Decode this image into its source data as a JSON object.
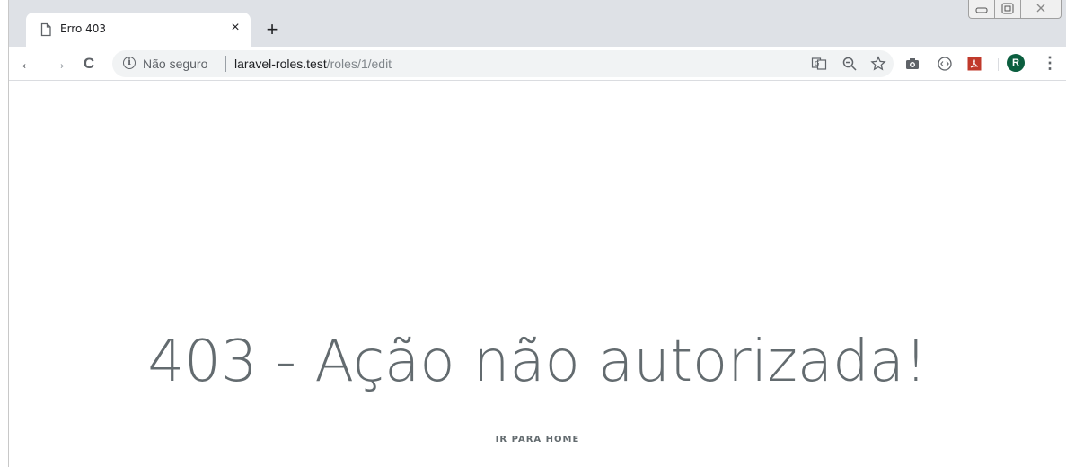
{
  "browser": {
    "tab": {
      "title": "Erro 403",
      "close_glyph": "×"
    },
    "new_tab_glyph": "+",
    "nav": {
      "back": "←",
      "forward": "→",
      "reload": "C"
    },
    "omnibox": {
      "security_icon": "i",
      "security_label": "Não seguro",
      "url_host": "laravel-roles.test",
      "url_path": "/roles/1/edit"
    },
    "avatar_initial": "R",
    "menu_glyph": "⋮"
  },
  "page": {
    "headline": "403 - Ação não autorizada!",
    "home_link": "IR PARA HOME"
  },
  "colors": {
    "tabstrip": "#dee1e6",
    "text": "#636b6f",
    "avatar": "#0b5e3f",
    "pdf_icon": "#c0392b"
  }
}
